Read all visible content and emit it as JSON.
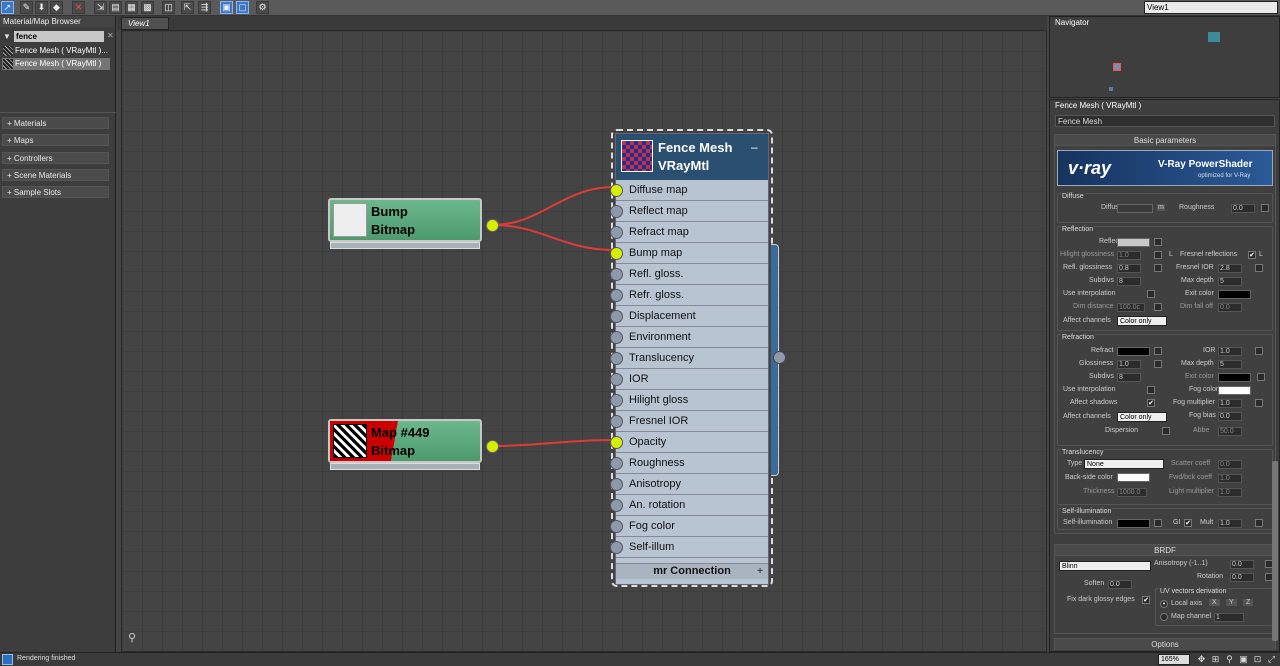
{
  "toolbar": {
    "icons": [
      "select-icon",
      "pick-material-icon",
      "put-material-icon",
      "assign-material-icon",
      "delete-icon",
      "move-children-icon",
      "lay-out-icon",
      "material-map-icon",
      "show-background-icon",
      "show-end-result-icon",
      "go-to-parent-icon",
      "layout-all-icon",
      "layout-children-icon",
      "material-browser-icon",
      "parameter-editor-icon",
      "select-by-material-icon"
    ],
    "view_selector": "View1"
  },
  "browser": {
    "title": "Material/Map Browser",
    "search_value": "fence",
    "results": [
      "Fence Mesh  ( VRayMtl )...",
      "Fence Mesh  ( VRayMtl )"
    ],
    "categories": [
      "+ Materials",
      "+ Maps",
      "+ Controllers",
      "+ Scene Materials",
      "+ Sample Slots"
    ]
  },
  "view": {
    "tab": "View1"
  },
  "nodes": {
    "bump": {
      "line1": "Bump",
      "line2": "Bitmap"
    },
    "opacity": {
      "line1": "Map #449",
      "line2": "Bitmap"
    },
    "material": {
      "name": "Fence Mesh",
      "type": "VRayMtl",
      "minimize": "–",
      "slots": [
        "Diffuse map",
        "Reflect map",
        "Refract map",
        "Bump map",
        "Refl. gloss.",
        "Refr. gloss.",
        "Displacement",
        "Environment",
        "Translucency",
        "IOR",
        "Hilight gloss",
        "Fresnel IOR",
        "Opacity",
        "Roughness",
        "Anisotropy",
        "An. rotation",
        "Fog color",
        "Self-illum"
      ],
      "connected_slots": [
        "Diffuse map",
        "Bump map",
        "Opacity"
      ],
      "mr_connection": "mr Connection",
      "mr_plus": "+"
    }
  },
  "navigator": {
    "title": "Navigator"
  },
  "params": {
    "title": "Fence Mesh  ( VRayMtl )",
    "name_field": "Fence Mesh",
    "basic_parameters": "Basic parameters",
    "banner_logo": "v·ray",
    "banner_title": "V-Ray PowerShader",
    "banner_sub": "optimized for V-Ray",
    "diffuse": {
      "group": "Diffuse",
      "diffuse_label": "Diffuse",
      "m": "m",
      "roughness_label": "Roughness",
      "roughness": "0.0"
    },
    "reflection": {
      "group": "Reflection",
      "reflect": "Reflect",
      "hilight_glossiness": "Hilight glossiness",
      "hilight_value": "1.0",
      "L": "L",
      "fresnel_reflections": "Fresnel reflections",
      "refl_glossiness": "Refl. glossiness",
      "refl_value": "0.8",
      "fresnel_ior": "Fresnel IOR",
      "fresnel_ior_value": "2.8",
      "subdivs": "Subdivs",
      "subdivs_value": "8",
      "max_depth": "Max depth",
      "max_depth_value": "5",
      "use_interpolation": "Use interpolation",
      "exit_color": "Exit color",
      "dim_distance": "Dim distance",
      "dim_distance_value": "100.0c",
      "dim_fall_off": "Dim fall off",
      "dim_fall_off_value": "0.0",
      "affect_channels": "Affect channels",
      "affect_channels_value": "Color only"
    },
    "refraction": {
      "group": "Refraction",
      "refract": "Refract",
      "ior": "IOR",
      "ior_value": "1.0",
      "glossiness": "Glossiness",
      "glossiness_value": "1.0",
      "max_depth": "Max depth",
      "max_depth_value": "5",
      "subdivs": "Subdivs",
      "subdivs_value": "8",
      "exit_color": "Exit color",
      "use_interpolation": "Use interpolation",
      "fog_color": "Fog color",
      "affect_shadows": "Affect shadows",
      "fog_multiplier": "Fog multiplier",
      "fog_multiplier_value": "1.0",
      "affect_channels": "Affect channels",
      "affect_channels_value": "Color only",
      "fog_bias": "Fog bias",
      "fog_bias_value": "0.0",
      "dispersion": "Dispersion",
      "abbe": "Abbe",
      "abbe_value": "50.0"
    },
    "translucency": {
      "group": "Translucency",
      "type": "Type",
      "type_value": "None",
      "scatter_coeff": "Scatter coeff",
      "scatter_value": "0.0",
      "back_side_color": "Back-side color",
      "fwd_bck_coeff": "Fwd/bck coeff",
      "fwd_bck_value": "1.0",
      "thickness": "Thickness",
      "thickness_value": "1000.0",
      "light_multiplier": "Light multiplier",
      "light_multiplier_value": "1.0"
    },
    "self_illum": {
      "group": "Self-illumination",
      "label": "Self-illumination",
      "gi": "GI",
      "mult": "Mult",
      "mult_value": "1.0"
    },
    "brdf": {
      "title": "BRDF",
      "type_value": "Blinn",
      "anisotropy": "Anisotropy (-1..1)",
      "anisotropy_value": "0.0",
      "rotation": "Rotation",
      "rotation_value": "0.0",
      "soften": "Soften",
      "soften_value": "0.0",
      "uv_vectors": "UV vectors derivation",
      "fix_dark": "Fix dark glossy edges",
      "local_axis": "Local axis",
      "x": "X",
      "y": "Y",
      "z": "Z",
      "map_channel": "Map channel",
      "map_channel_value": "1"
    },
    "options": "Options"
  },
  "status": {
    "text": "Rendering finished",
    "zoom": "165%",
    "icons": [
      "pan-icon",
      "zoom-extents-icon",
      "zoom-icon",
      "zoom-region-icon",
      "pan-view-icon",
      "maximize-icon"
    ]
  },
  "colors": {
    "wire": "#e03a3a",
    "socket_active": "#d4f000",
    "node_green": "#5aa87c",
    "material_header": "#2b4f70"
  }
}
